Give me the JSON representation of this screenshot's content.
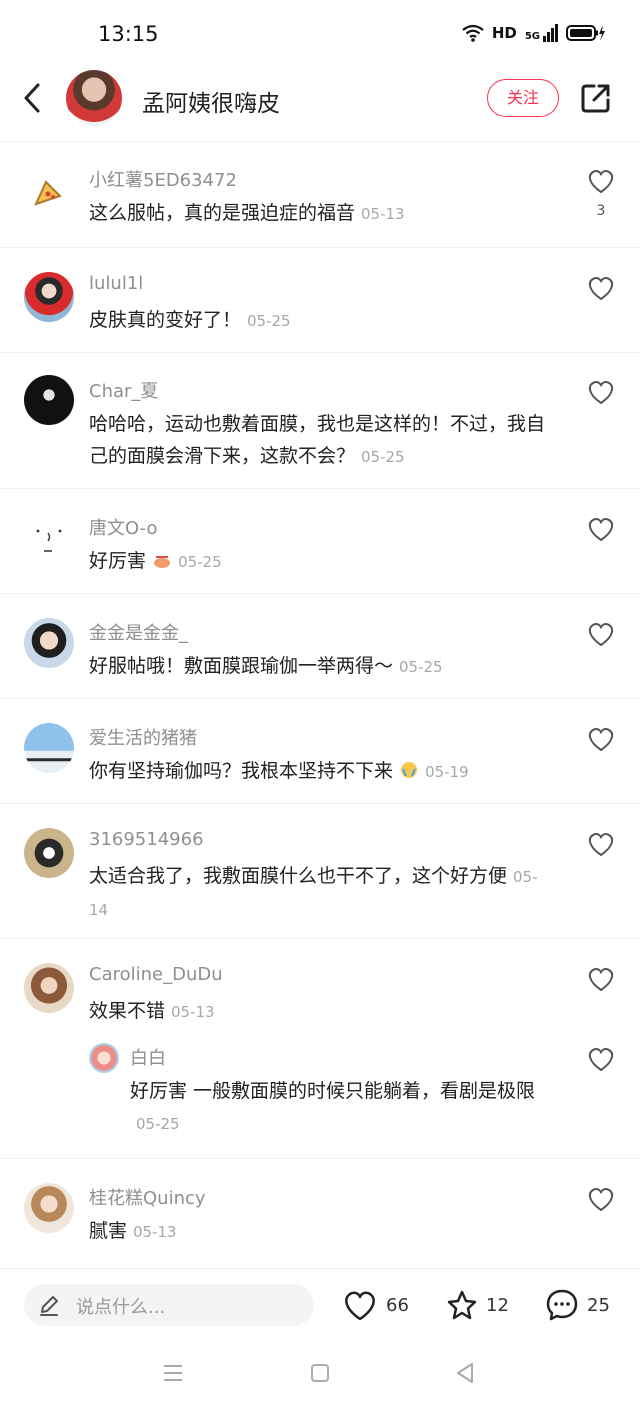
{
  "status": {
    "time": "13:15",
    "network": "HD",
    "signal_label": "5G"
  },
  "header": {
    "author_name": "孟阿姨很嗨皮",
    "follow_label": "关注"
  },
  "comments": [
    {
      "user": "小红薯5ED63472",
      "text": "这么服帖，真的是强迫症的福音",
      "date": "05-13",
      "likes": "3"
    },
    {
      "user": "lulul1l",
      "text": "皮肤真的变好了！",
      "date": "05-25"
    },
    {
      "user": "Char_夏",
      "text": "哈哈哈，运动也敷着面膜，我也是这样的！不过，我自己的面膜会滑下来，这款不会？",
      "date": "05-25"
    },
    {
      "user": "唐文O-o",
      "text": "好厉害",
      "date": "05-25"
    },
    {
      "user": "金金是金金_",
      "text": "好服帖哦！敷面膜跟瑜伽一举两得～",
      "date": "05-25"
    },
    {
      "user": "爱生活的猪猪",
      "text": "你有坚持瑜伽吗？我根本坚持不下来",
      "date": "05-19"
    },
    {
      "user": "3169514966",
      "text": "太适合我了，我敷面膜什么也干不了，这个好方便",
      "date": "05-14"
    },
    {
      "user": "Caroline_DuDu",
      "text": "效果不错",
      "date": "05-13",
      "reply": {
        "user": "白白",
        "text": "好厉害 一般敷面膜的时候只能躺着，看剧是极限",
        "date": "05-25"
      }
    },
    {
      "user": "桂花糕Quincy",
      "text": "腻害",
      "date": "05-13"
    }
  ],
  "bottom": {
    "input_placeholder": "说点什么...",
    "likes": "66",
    "collects": "12",
    "comments": "25"
  },
  "colors": {
    "accent": "#ff2e4d",
    "muted": "#8f8f8f"
  }
}
